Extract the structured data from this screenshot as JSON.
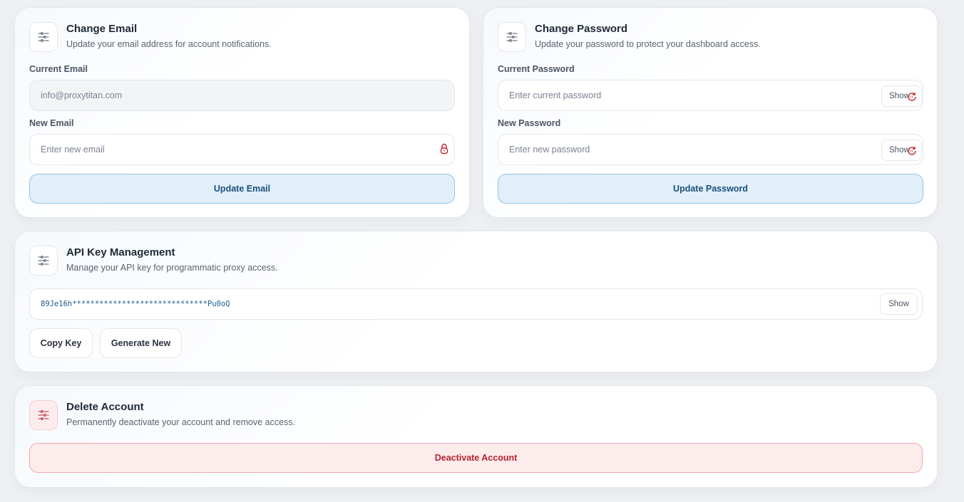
{
  "email_card": {
    "title": "Change Email",
    "description": "Update your email address for account notifications.",
    "icon": "sliders-icon",
    "current_label": "Current Email",
    "current_value": "info@proxytitan.com",
    "new_label": "New Email",
    "new_placeholder": "Enter new email",
    "submit_label": "Update Email"
  },
  "password_card": {
    "title": "Change Password",
    "description": "Update your password to protect your dashboard access.",
    "icon": "sliders-icon",
    "current_label": "Current Password",
    "current_placeholder": "Enter current password",
    "new_label": "New Password",
    "new_placeholder": "Enter new password",
    "show_label": "Show",
    "submit_label": "Update Password"
  },
  "api_card": {
    "title": "API Key Management",
    "description": "Manage your API key for programmatic proxy access.",
    "icon": "sliders-icon",
    "masked_key": "89Je16h******************************Pu0oQ",
    "show_label": "Show",
    "copy_label": "Copy Key",
    "generate_label": "Generate New"
  },
  "delete_card": {
    "title": "Delete Account",
    "description": "Permanently deactivate your account and remove access.",
    "icon": "sliders-icon",
    "action_label": "Deactivate Account"
  },
  "colors": {
    "primary_bg": "#e0effa",
    "primary_border": "#93c5e8",
    "primary_text": "#1d4f7a",
    "danger_bg": "#fdecec",
    "danger_border": "#f0a9b0",
    "danger_text": "#b42330",
    "page_bg": "#eef0f3"
  }
}
